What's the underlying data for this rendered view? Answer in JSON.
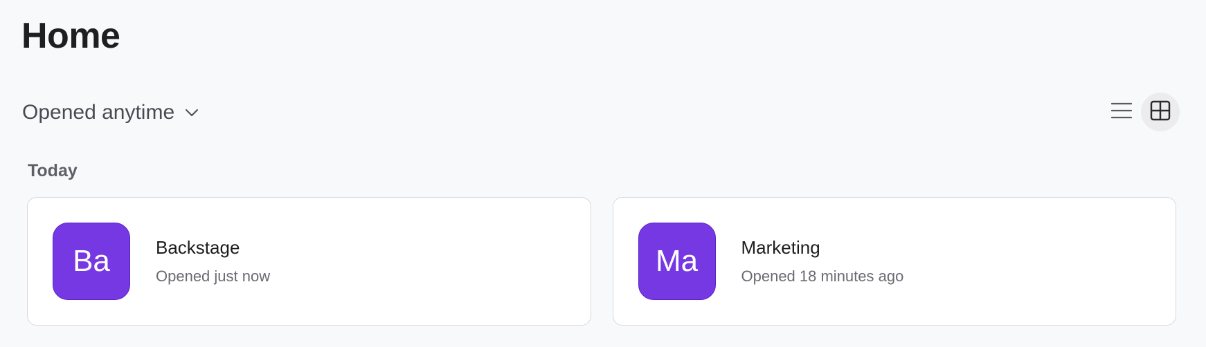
{
  "page": {
    "title": "Home"
  },
  "filter": {
    "label": "Opened anytime",
    "icon": "chevron-down-icon"
  },
  "view_toggle": {
    "list_icon": "list-view-icon",
    "grid_icon": "grid-view-icon",
    "active": "grid"
  },
  "sections": [
    {
      "heading": "Today",
      "items": [
        {
          "initials": "Ba",
          "name": "Backstage",
          "subtitle": "Opened just now",
          "avatar_color": "#7638e3"
        },
        {
          "initials": "Ma",
          "name": "Marketing",
          "subtitle": "Opened 18 minutes ago",
          "avatar_color": "#7638e3"
        }
      ]
    }
  ]
}
